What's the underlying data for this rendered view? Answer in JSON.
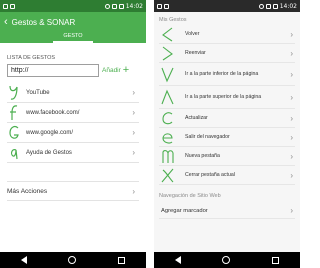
{
  "colors": {
    "brand": "#4caf50",
    "status_left": "#2e7d32",
    "gesture_stroke": "#4caf50"
  },
  "statusbar": {
    "time": "14:02"
  },
  "left": {
    "appbar": {
      "title": "Gestos & SONAR"
    },
    "tab": "GESTO",
    "list_label": "LISTA DE GESTOS",
    "url_value": "http://",
    "add_label": "Añadir",
    "gestures": [
      {
        "label": "YouTube",
        "icon": "gesture-y-icon"
      },
      {
        "label": "www.facebook.com/",
        "icon": "gesture-f-icon"
      },
      {
        "label": "www.google.com/",
        "icon": "gesture-g-icon"
      },
      {
        "label": "Ayuda de Gestos",
        "icon": "gesture-a-icon"
      }
    ],
    "more_actions": "Más Acciones"
  },
  "right": {
    "header": "Mis Gestos",
    "items": [
      {
        "label": "Volver",
        "icon": "gesture-back-icon"
      },
      {
        "label": "Reenviar",
        "icon": "gesture-forward-icon"
      },
      {
        "label": "Ir a la parte inferior de la página",
        "icon": "gesture-bottom-icon"
      },
      {
        "label": "Ir a la parte superior de la página",
        "icon": "gesture-top-icon"
      },
      {
        "label": "Actualizar",
        "icon": "gesture-refresh-icon"
      },
      {
        "label": "Salir del navegador",
        "icon": "gesture-exit-icon"
      },
      {
        "label": "Nueva pestaña",
        "icon": "gesture-newtab-icon"
      },
      {
        "label": "Cerrar pestaña actual",
        "icon": "gesture-closetab-icon"
      }
    ],
    "section2": "Navegación de Sitio Web",
    "bookmark": "Agregar marcador"
  }
}
